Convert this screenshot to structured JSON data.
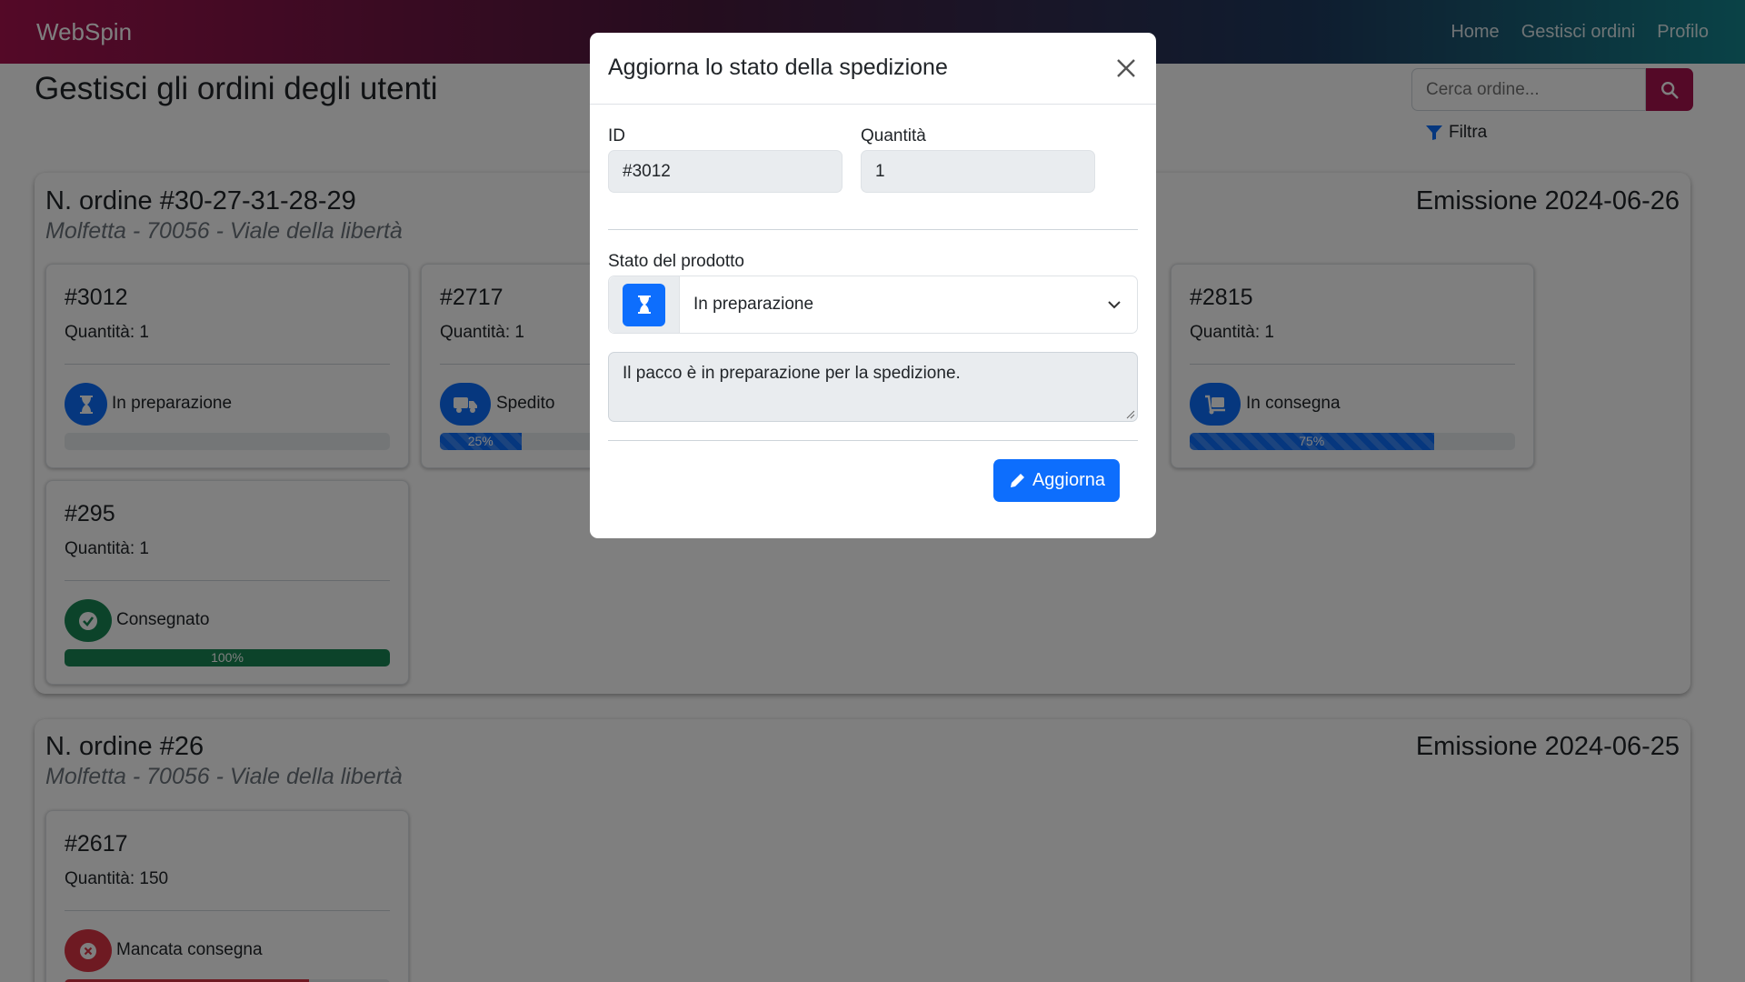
{
  "navbar": {
    "brand": "WebSpin",
    "links": [
      "Home",
      "Gestisci ordini",
      "Profilo"
    ]
  },
  "page": {
    "title": "Gestisci gli ordini degli utenti",
    "search_placeholder": "Cerca ordine...",
    "filter_label": "Filtra"
  },
  "orders": [
    {
      "title": "N. ordine #30-27-31-28-29",
      "date": "Emissione 2024-06-26",
      "address": "Molfetta - 70056 - Viale della libertà",
      "items": [
        {
          "id": "#3012",
          "qty": "Quantità: 1",
          "status": "In preparazione",
          "icon": "hourglass-icon",
          "progress": 0,
          "progress_label": ""
        },
        {
          "id": "#2717",
          "qty": "Quantità: 1",
          "status": "Spedito",
          "icon": "truck-icon",
          "progress": 25,
          "progress_label": "25%"
        },
        {
          "id": "#2815",
          "qty": "Quantità: 1",
          "status": "In consegna",
          "icon": "dolly-icon",
          "progress": 75,
          "progress_label": "75%"
        },
        {
          "id": "#295",
          "qty": "Quantità: 1",
          "status": "Consegnato",
          "icon": "check-circle-icon",
          "progress": 100,
          "progress_label": "100%"
        }
      ]
    },
    {
      "title": "N. ordine #26",
      "date": "Emissione 2024-06-25",
      "address": "Molfetta - 70056 - Viale della libertà",
      "items": [
        {
          "id": "#2617",
          "qty": "Quantità: 150",
          "status": "Mancata consegna",
          "icon": "x-circle-icon",
          "progress": 75,
          "progress_label": ""
        }
      ]
    }
  ],
  "modal": {
    "title": "Aggiorna lo stato della spedizione",
    "id_label": "ID",
    "id_value": "#3012",
    "qty_label": "Quantità",
    "qty_value": "1",
    "status_label": "Stato del prodotto",
    "status_value": "In preparazione",
    "description": "Il pacco è in preparazione per la spedizione.",
    "submit_label": "Aggiorna"
  },
  "colors": {
    "primary": "#0d6efd",
    "brand": "#a8124f",
    "success": "#198754",
    "danger": "#dc3545"
  }
}
